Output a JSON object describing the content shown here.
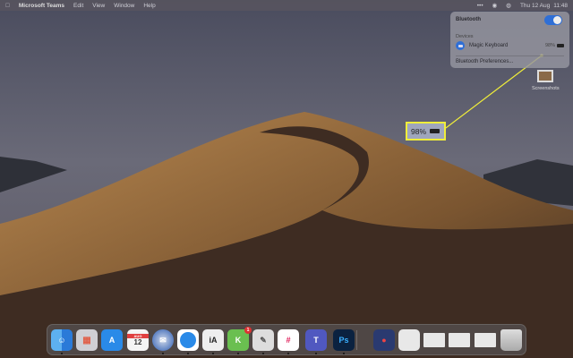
{
  "menubar": {
    "app": "Microsoft Teams",
    "items": [
      "Edit",
      "View",
      "Window",
      "Help"
    ],
    "date": "Thu 12 Aug",
    "time": "11:48"
  },
  "bluetooth": {
    "title": "Bluetooth",
    "enabled": true,
    "section": "Devices",
    "device": "Magic Keyboard",
    "battery": "98%",
    "preferences": "Bluetooth Preferences..."
  },
  "desktop": {
    "file_label": "Screenshots"
  },
  "callout": {
    "battery": "98%"
  },
  "colors": {
    "accent": "#2f6fd6",
    "highlight": "#f0ee3a"
  },
  "dock": {
    "calendar_month": "AUG",
    "calendar_day": "12",
    "ia_label": "iA",
    "ps_label": "Ps",
    "teams_label": "T",
    "kanban_badge": "1"
  }
}
